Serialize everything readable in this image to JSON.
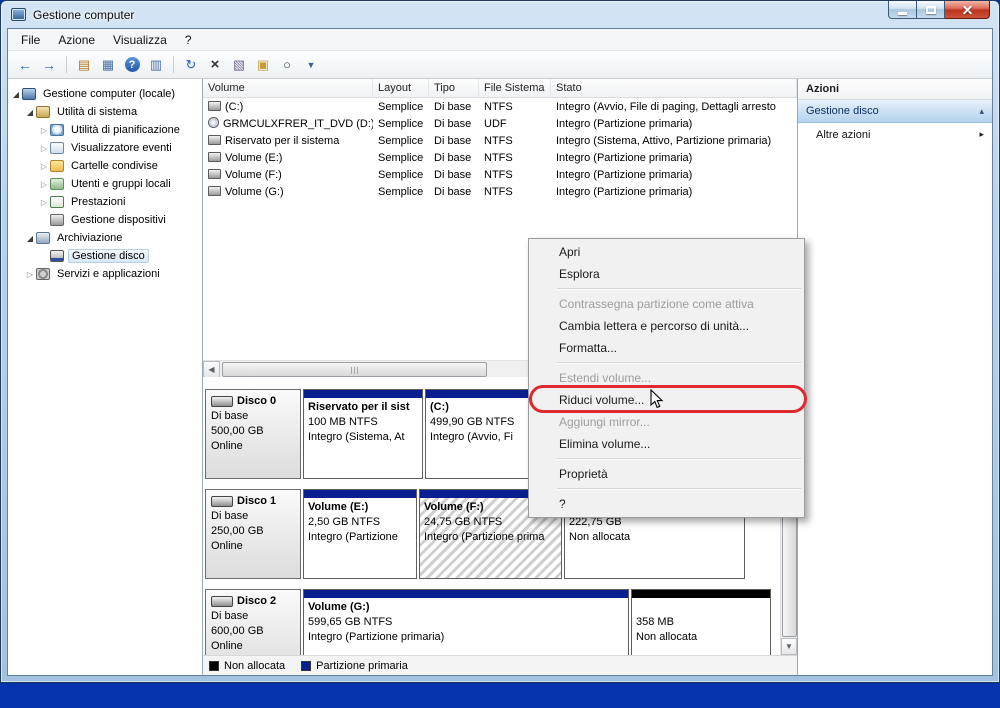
{
  "window": {
    "title": "Gestione computer"
  },
  "menubar": {
    "items": [
      "File",
      "Azione",
      "Visualizza",
      "?"
    ]
  },
  "toolbar": {
    "buttons": [
      {
        "name": "back",
        "glyph": "←"
      },
      {
        "name": "forward",
        "glyph": "→"
      },
      {
        "name": "show-console-tree",
        "glyph": "▤"
      },
      {
        "name": "export-list",
        "glyph": "▦"
      },
      {
        "name": "help",
        "glyph": "?"
      },
      {
        "name": "show-action-pane",
        "glyph": "▥"
      },
      {
        "name": "refresh",
        "glyph": "↻"
      },
      {
        "name": "delete",
        "glyph": "×"
      },
      {
        "name": "properties",
        "glyph": "▧"
      },
      {
        "name": "open",
        "glyph": "▣"
      },
      {
        "name": "find",
        "glyph": "○"
      },
      {
        "name": "filter",
        "glyph": "▼"
      }
    ]
  },
  "tree": {
    "items": [
      {
        "label": "Gestione computer (locale)",
        "level": 0,
        "state": "expanded",
        "icon": "computer-icon"
      },
      {
        "label": "Utilità di sistema",
        "level": 1,
        "state": "expanded",
        "icon": "system-tools-icon"
      },
      {
        "label": "Utilità di pianificazione",
        "level": 2,
        "state": "collapsed",
        "icon": "task-scheduler-icon"
      },
      {
        "label": "Visualizzatore eventi",
        "level": 2,
        "state": "collapsed",
        "icon": "event-viewer-icon"
      },
      {
        "label": "Cartelle condivise",
        "level": 2,
        "state": "collapsed",
        "icon": "shared-folders-icon"
      },
      {
        "label": "Utenti e gruppi locali",
        "level": 2,
        "state": "collapsed",
        "icon": "local-users-icon"
      },
      {
        "label": "Prestazioni",
        "level": 2,
        "state": "collapsed",
        "icon": "performance-icon"
      },
      {
        "label": "Gestione dispositivi",
        "level": 2,
        "state": "leaf",
        "icon": "device-manager-icon"
      },
      {
        "label": "Archiviazione",
        "level": 1,
        "state": "expanded",
        "icon": "storage-icon"
      },
      {
        "label": "Gestione disco",
        "level": 2,
        "state": "leaf",
        "icon": "disk-management-icon",
        "selected": true
      },
      {
        "label": "Servizi e applicazioni",
        "level": 1,
        "state": "collapsed",
        "icon": "services-icon"
      }
    ]
  },
  "volume_list": {
    "columns": [
      "Volume",
      "Layout",
      "Tipo",
      "File Sistema",
      "Stato"
    ],
    "rows": [
      {
        "icon": "drive",
        "volume": "(C:)",
        "layout": "Semplice",
        "tipo": "Di base",
        "fs": "NTFS",
        "stato": "Integro (Avvio, File di paging, Dettagli arresto"
      },
      {
        "icon": "dvd",
        "volume": "GRMCULXFRER_IT_DVD (D:)",
        "layout": "Semplice",
        "tipo": "Di base",
        "fs": "UDF",
        "stato": "Integro (Partizione primaria)"
      },
      {
        "icon": "drive",
        "volume": "Riservato per il sistema",
        "layout": "Semplice",
        "tipo": "Di base",
        "fs": "NTFS",
        "stato": "Integro (Sistema, Attivo, Partizione primaria)"
      },
      {
        "icon": "drive",
        "volume": "Volume (E:)",
        "layout": "Semplice",
        "tipo": "Di base",
        "fs": "NTFS",
        "stato": "Integro (Partizione primaria)"
      },
      {
        "icon": "drive",
        "volume": "Volume (F:)",
        "layout": "Semplice",
        "tipo": "Di base",
        "fs": "NTFS",
        "stato": "Integro (Partizione primaria)"
      },
      {
        "icon": "drive",
        "volume": "Volume (G:)",
        "layout": "Semplice",
        "tipo": "Di base",
        "fs": "NTFS",
        "stato": "Integro (Partizione primaria)"
      }
    ]
  },
  "disk_view": {
    "disks": [
      {
        "name": "Disco 0",
        "type": "Di base",
        "size": "500,00 GB",
        "status": "Online",
        "partitions": [
          {
            "title": "Riservato per il sist",
            "line2": "100 MB NTFS",
            "line3": "Integro (Sistema, At",
            "kind": "primary"
          },
          {
            "title": "(C:)",
            "line2": "499,90 GB NTFS",
            "line3": "Integro (Avvio, Fi",
            "kind": "primary"
          }
        ]
      },
      {
        "name": "Disco 1",
        "type": "Di base",
        "size": "250,00 GB",
        "status": "Online",
        "partitions": [
          {
            "title": "Volume (E:)",
            "line2": "2,50 GB NTFS",
            "line3": "Integro (Partizione",
            "kind": "primary"
          },
          {
            "title": "Volume (F:)",
            "line2": "24,75 GB NTFS",
            "line3": "Integro (Partizione prima",
            "kind": "primary",
            "selected": true
          },
          {
            "title": "",
            "line2": "222,75 GB",
            "line3": "Non allocata",
            "kind": "unallocated"
          }
        ]
      },
      {
        "name": "Disco 2",
        "type": "Di base",
        "size": "600,00 GB",
        "status": "Online",
        "partitions": [
          {
            "title": "Volume (G:)",
            "line2": "599,65 GB NTFS",
            "line3": "Integro (Partizione primaria)",
            "kind": "primary"
          },
          {
            "title": "",
            "line2": "358 MB",
            "line3": "Non allocata",
            "kind": "unallocated"
          }
        ]
      }
    ],
    "legend": [
      {
        "label": "Non allocata",
        "color": "#000000"
      },
      {
        "label": "Partizione primaria",
        "color": "#0a1f8f"
      }
    ]
  },
  "actions_pane": {
    "title": "Azioni",
    "sections": [
      {
        "label": "Gestione disco"
      },
      {
        "label": "Altre azioni"
      }
    ]
  },
  "context_menu": {
    "items": [
      {
        "label": "Apri",
        "enabled": true
      },
      {
        "label": "Esplora",
        "enabled": true
      },
      {
        "type": "separator"
      },
      {
        "label": "Contrassegna partizione come attiva",
        "enabled": false
      },
      {
        "label": "Cambia lettera e percorso di unità...",
        "enabled": true
      },
      {
        "label": "Formatta...",
        "enabled": true
      },
      {
        "type": "separator"
      },
      {
        "label": "Estendi volume...",
        "enabled": false
      },
      {
        "label": "Riduci volume...",
        "enabled": true,
        "highlighted": true
      },
      {
        "label": "Aggiungi mirror...",
        "enabled": false
      },
      {
        "label": "Elimina volume...",
        "enabled": true
      },
      {
        "type": "separator"
      },
      {
        "label": "Proprietà",
        "enabled": true
      },
      {
        "type": "separator"
      },
      {
        "label": "?",
        "enabled": true
      }
    ]
  },
  "colors": {
    "primary_partition": "#0a1f8f",
    "unallocated": "#000000",
    "annotation_red": "#dc2a2e",
    "actions_section_blue": "#b4d2ee",
    "desktop_background": "#0433ad"
  }
}
